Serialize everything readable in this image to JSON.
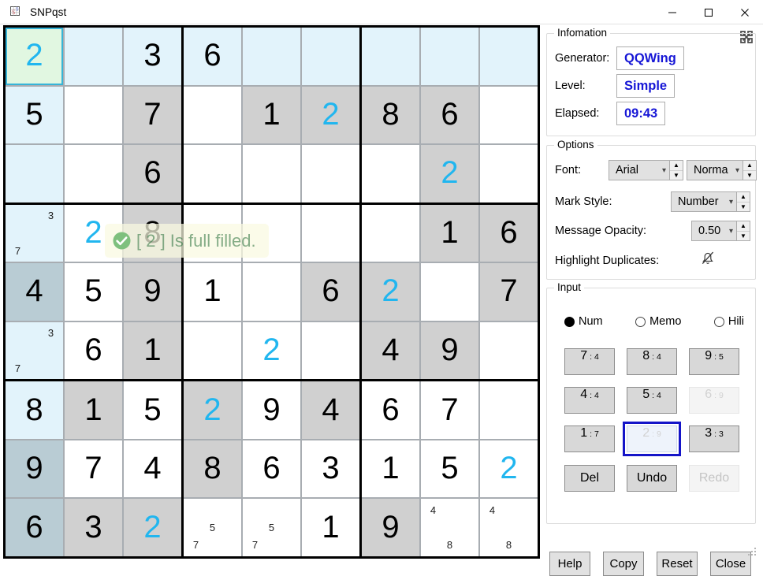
{
  "window": {
    "title": "SNPqst",
    "icon": "sudoku-app-icon",
    "controls": [
      {
        "name": "minimize-button",
        "glyph": "minimize-icon"
      },
      {
        "name": "maximize-button",
        "glyph": "maximize-icon"
      },
      {
        "name": "close-button",
        "glyph": "close-icon"
      }
    ]
  },
  "colors": {
    "accent_number": "#21b6ef",
    "given_cell": "#d0d0d0",
    "highlight_cell": "#e2f3fb",
    "given_highlight_cell": "#b9ccd4",
    "selected_cell": "#e1f7e1",
    "selected_border": "#36b4d8",
    "value_text": "#1616d6",
    "toast_text": "#3b7c4a",
    "toast_bg": "#fafae0",
    "keypad_selected_ring": "#1414c8"
  },
  "toast": {
    "icon": "check-circle-icon",
    "message": "[ 2 ] Is full filled."
  },
  "board": {
    "rows": [
      [
        {
          "v": "2",
          "state": "selected",
          "accent": true
        },
        {
          "v": "",
          "state": "highlight"
        },
        {
          "v": "3",
          "state": "highlight"
        },
        {
          "v": "6",
          "state": "highlight"
        },
        {
          "v": "",
          "state": "highlight"
        },
        {
          "v": "",
          "state": "highlight"
        },
        {
          "v": "",
          "state": "highlight"
        },
        {
          "v": "",
          "state": "highlight"
        },
        {
          "v": "",
          "state": "highlight"
        }
      ],
      [
        {
          "v": "5",
          "state": "highlight"
        },
        {
          "v": "",
          "state": "normal"
        },
        {
          "v": "7",
          "state": "given"
        },
        {
          "v": "",
          "state": "normal"
        },
        {
          "v": "1",
          "state": "given"
        },
        {
          "v": "2",
          "state": "given",
          "accent": true
        },
        {
          "v": "8",
          "state": "given"
        },
        {
          "v": "6",
          "state": "given"
        },
        {
          "v": "",
          "state": "normal"
        }
      ],
      [
        {
          "v": "",
          "state": "highlight"
        },
        {
          "v": "",
          "state": "normal"
        },
        {
          "v": "6",
          "state": "given"
        },
        {
          "v": "",
          "state": "normal"
        },
        {
          "v": "",
          "state": "normal"
        },
        {
          "v": "",
          "state": "normal"
        },
        {
          "v": "",
          "state": "normal"
        },
        {
          "v": "2",
          "state": "given",
          "accent": true
        },
        {
          "v": "",
          "state": "normal"
        }
      ],
      [
        {
          "v": "",
          "state": "highlight",
          "marks": [
            "3",
            "7"
          ],
          "mark_pos": [
            3,
            7
          ]
        },
        {
          "v": "2",
          "state": "normal",
          "accent": true
        },
        {
          "v": "8",
          "state": "given"
        },
        {
          "v": "",
          "state": "normal"
        },
        {
          "v": "",
          "state": "normal"
        },
        {
          "v": "",
          "state": "normal"
        },
        {
          "v": "",
          "state": "normal"
        },
        {
          "v": "1",
          "state": "given"
        },
        {
          "v": "6",
          "state": "given"
        }
      ],
      [
        {
          "v": "4",
          "state": "given-highlight"
        },
        {
          "v": "5",
          "state": "normal"
        },
        {
          "v": "9",
          "state": "given"
        },
        {
          "v": "1",
          "state": "normal"
        },
        {
          "v": "",
          "state": "normal"
        },
        {
          "v": "6",
          "state": "given"
        },
        {
          "v": "2",
          "state": "given",
          "accent": true
        },
        {
          "v": "",
          "state": "normal"
        },
        {
          "v": "7",
          "state": "given"
        }
      ],
      [
        {
          "v": "",
          "state": "highlight",
          "marks": [
            "3",
            "7"
          ],
          "mark_pos": [
            3,
            7
          ]
        },
        {
          "v": "6",
          "state": "normal"
        },
        {
          "v": "1",
          "state": "given"
        },
        {
          "v": "",
          "state": "normal"
        },
        {
          "v": "2",
          "state": "normal",
          "accent": true
        },
        {
          "v": "",
          "state": "normal"
        },
        {
          "v": "4",
          "state": "given"
        },
        {
          "v": "9",
          "state": "given"
        },
        {
          "v": "",
          "state": "normal"
        }
      ],
      [
        {
          "v": "8",
          "state": "highlight"
        },
        {
          "v": "1",
          "state": "given"
        },
        {
          "v": "5",
          "state": "normal"
        },
        {
          "v": "2",
          "state": "given",
          "accent": true
        },
        {
          "v": "9",
          "state": "normal"
        },
        {
          "v": "4",
          "state": "given"
        },
        {
          "v": "6",
          "state": "normal"
        },
        {
          "v": "7",
          "state": "normal"
        },
        {
          "v": "",
          "state": "normal"
        }
      ],
      [
        {
          "v": "9",
          "state": "given-highlight"
        },
        {
          "v": "7",
          "state": "normal"
        },
        {
          "v": "4",
          "state": "normal"
        },
        {
          "v": "8",
          "state": "given"
        },
        {
          "v": "6",
          "state": "normal"
        },
        {
          "v": "3",
          "state": "normal"
        },
        {
          "v": "1",
          "state": "normal"
        },
        {
          "v": "5",
          "state": "normal"
        },
        {
          "v": "2",
          "state": "normal",
          "accent": true
        }
      ],
      [
        {
          "v": "6",
          "state": "given-highlight"
        },
        {
          "v": "3",
          "state": "given"
        },
        {
          "v": "2",
          "state": "given",
          "accent": true
        },
        {
          "v": "",
          "state": "normal",
          "marks": [
            "5",
            "7"
          ],
          "mark_pos": [
            5,
            7
          ]
        },
        {
          "v": "",
          "state": "normal",
          "marks": [
            "5",
            "7"
          ],
          "mark_pos": [
            5,
            7
          ]
        },
        {
          "v": "1",
          "state": "normal"
        },
        {
          "v": "9",
          "state": "given"
        },
        {
          "v": "",
          "state": "normal",
          "marks": [
            "4",
            "8"
          ],
          "mark_pos": [
            1,
            8
          ]
        },
        {
          "v": "",
          "state": "normal",
          "marks": [
            "4",
            "8"
          ],
          "mark_pos": [
            1,
            8
          ]
        }
      ]
    ]
  },
  "panel": {
    "expand_icon": "fullscreen-expand-icon",
    "information": {
      "legend": "Infomation",
      "generator_label": "Generator:",
      "generator_value": "QQWing",
      "level_label": "Level:",
      "level_value": "Simple",
      "elapsed_label": "Elapsed:",
      "elapsed_value": "09:43"
    },
    "options": {
      "legend": "Options",
      "font_label": "Font:",
      "font_family_value": "Arial",
      "font_style_value": "Norma",
      "mark_style_label": "Mark Style:",
      "mark_style_value": "Number",
      "message_opacity_label": "Message Opacity:",
      "message_opacity_value": "0.50",
      "highlight_duplicates_label": "Highlight Duplicates:",
      "highlight_duplicates_icon": "bell-off-icon"
    },
    "input": {
      "legend": "Input",
      "modes": [
        {
          "label": "Num",
          "selected": true
        },
        {
          "label": "Memo",
          "selected": false
        },
        {
          "label": "Hili",
          "selected": false
        }
      ],
      "keys": [
        {
          "digit": "7",
          "count": "4",
          "disabled": false,
          "selected": false
        },
        {
          "digit": "8",
          "count": "4",
          "disabled": false,
          "selected": false
        },
        {
          "digit": "9",
          "count": "5",
          "disabled": false,
          "selected": false
        },
        {
          "digit": "4",
          "count": "4",
          "disabled": false,
          "selected": false
        },
        {
          "digit": "5",
          "count": "4",
          "disabled": false,
          "selected": false
        },
        {
          "digit": "6",
          "count": "9",
          "disabled": true,
          "selected": false
        },
        {
          "digit": "1",
          "count": "7",
          "disabled": false,
          "selected": false
        },
        {
          "digit": "2",
          "count": "9",
          "disabled": true,
          "selected": true
        },
        {
          "digit": "3",
          "count": "3",
          "disabled": false,
          "selected": false
        }
      ],
      "actions": [
        {
          "label": "Del",
          "disabled": false
        },
        {
          "label": "Undo",
          "disabled": false
        },
        {
          "label": "Redo",
          "disabled": true
        }
      ]
    },
    "footer": [
      {
        "label": "Help"
      },
      {
        "label": "Copy"
      },
      {
        "label": "Reset"
      },
      {
        "label": "Close"
      }
    ]
  }
}
